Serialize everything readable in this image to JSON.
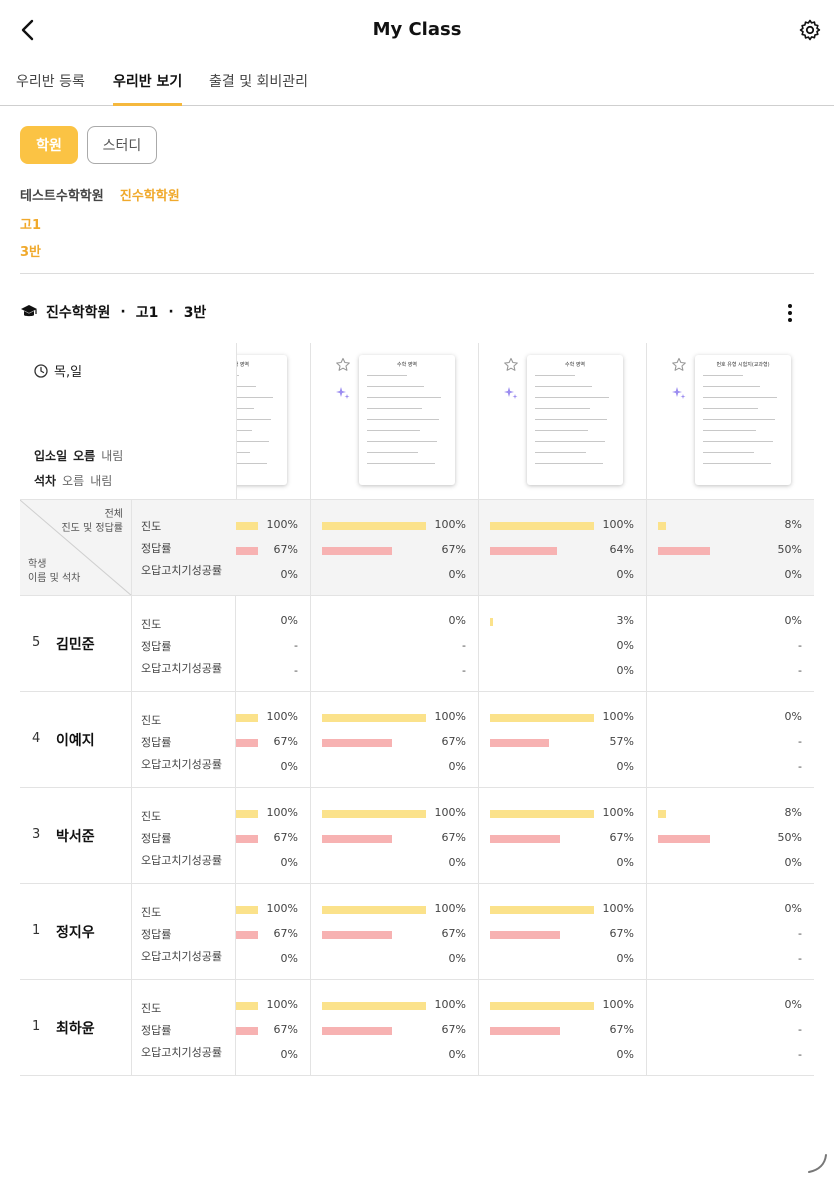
{
  "header": {
    "title": "My Class"
  },
  "tabs": [
    {
      "label": "우리반 등록"
    },
    {
      "label": "우리반 보기"
    },
    {
      "label": "출결 및 회비관리"
    }
  ],
  "segments": {
    "selected": "학원",
    "other": "스터디"
  },
  "filters": {
    "academies": [
      "테스트수학학원",
      "진수학학원"
    ],
    "grade": "고1",
    "class_name": "3반"
  },
  "class_header": {
    "academy": "진수학학원",
    "sep": "·",
    "grade": "고1",
    "class_name": "3반"
  },
  "schedule": "목,일",
  "sort": {
    "enroll": {
      "label": "입소일",
      "asc": "오름",
      "desc": "내림"
    },
    "rank": {
      "label": "석차",
      "asc": "오름",
      "desc": "내림"
    }
  },
  "corner": {
    "top_line1": "전체",
    "top_line2": "진도 및 정답률",
    "bottom_line1": "학생",
    "bottom_line2": "이름 및 석차"
  },
  "row_labels": {
    "progress": "진도",
    "accuracy": "정답률",
    "wrong_note": "오답고치기성공률"
  },
  "worksheets": [
    {
      "title": "수학 영역"
    },
    {
      "title": "수학 영역"
    },
    {
      "title": "수학 영역"
    },
    {
      "title": "번호 유형 시험지(교과형)"
    }
  ],
  "summary": [
    {
      "progress": "100%",
      "accuracy": "67%",
      "wrong": "0%",
      "p": 1.0,
      "a": 0.67
    },
    {
      "progress": "100%",
      "accuracy": "67%",
      "wrong": "0%",
      "p": 1.0,
      "a": 0.67
    },
    {
      "progress": "100%",
      "accuracy": "64%",
      "wrong": "0%",
      "p": 1.0,
      "a": 0.64
    },
    {
      "progress": "8%",
      "accuracy": "50%",
      "wrong": "0%",
      "p": 0.08,
      "a": 0.5
    }
  ],
  "students": [
    {
      "rank": "5",
      "name": "김민준",
      "cells": [
        {
          "progress": "0%",
          "accuracy": "-",
          "wrong": "-",
          "p": 0,
          "a": 0
        },
        {
          "progress": "0%",
          "accuracy": "-",
          "wrong": "-",
          "p": 0,
          "a": 0
        },
        {
          "progress": "3%",
          "accuracy": "0%",
          "wrong": "0%",
          "p": 0.03,
          "a": 0
        },
        {
          "progress": "0%",
          "accuracy": "-",
          "wrong": "-",
          "p": 0,
          "a": 0
        }
      ]
    },
    {
      "rank": "4",
      "name": "이예지",
      "cells": [
        {
          "progress": "100%",
          "accuracy": "67%",
          "wrong": "0%",
          "p": 1.0,
          "a": 0.67
        },
        {
          "progress": "100%",
          "accuracy": "67%",
          "wrong": "0%",
          "p": 1.0,
          "a": 0.67
        },
        {
          "progress": "100%",
          "accuracy": "57%",
          "wrong": "0%",
          "p": 1.0,
          "a": 0.57
        },
        {
          "progress": "0%",
          "accuracy": "-",
          "wrong": "-",
          "p": 0,
          "a": 0
        }
      ]
    },
    {
      "rank": "3",
      "name": "박서준",
      "cells": [
        {
          "progress": "100%",
          "accuracy": "67%",
          "wrong": "0%",
          "p": 1.0,
          "a": 0.67
        },
        {
          "progress": "100%",
          "accuracy": "67%",
          "wrong": "0%",
          "p": 1.0,
          "a": 0.67
        },
        {
          "progress": "100%",
          "accuracy": "67%",
          "wrong": "0%",
          "p": 1.0,
          "a": 0.67
        },
        {
          "progress": "8%",
          "accuracy": "50%",
          "wrong": "0%",
          "p": 0.08,
          "a": 0.5
        }
      ]
    },
    {
      "rank": "1",
      "name": "정지우",
      "cells": [
        {
          "progress": "100%",
          "accuracy": "67%",
          "wrong": "0%",
          "p": 1.0,
          "a": 0.67
        },
        {
          "progress": "100%",
          "accuracy": "67%",
          "wrong": "0%",
          "p": 1.0,
          "a": 0.67
        },
        {
          "progress": "100%",
          "accuracy": "67%",
          "wrong": "0%",
          "p": 1.0,
          "a": 0.67
        },
        {
          "progress": "0%",
          "accuracy": "-",
          "wrong": "-",
          "p": 0,
          "a": 0
        }
      ]
    },
    {
      "rank": "1",
      "name": "최하윤",
      "cells": [
        {
          "progress": "100%",
          "accuracy": "67%",
          "wrong": "0%",
          "p": 1.0,
          "a": 0.67
        },
        {
          "progress": "100%",
          "accuracy": "67%",
          "wrong": "0%",
          "p": 1.0,
          "a": 0.67
        },
        {
          "progress": "100%",
          "accuracy": "67%",
          "wrong": "0%",
          "p": 1.0,
          "a": 0.67
        },
        {
          "progress": "0%",
          "accuracy": "-",
          "wrong": "-",
          "p": 0,
          "a": 0
        }
      ]
    }
  ],
  "colors": {
    "accent": "#fbc344",
    "progress_bar": "#fbe28b",
    "accuracy_bar": "#f7b2b2",
    "summary_bg": "#f4f4f4"
  }
}
